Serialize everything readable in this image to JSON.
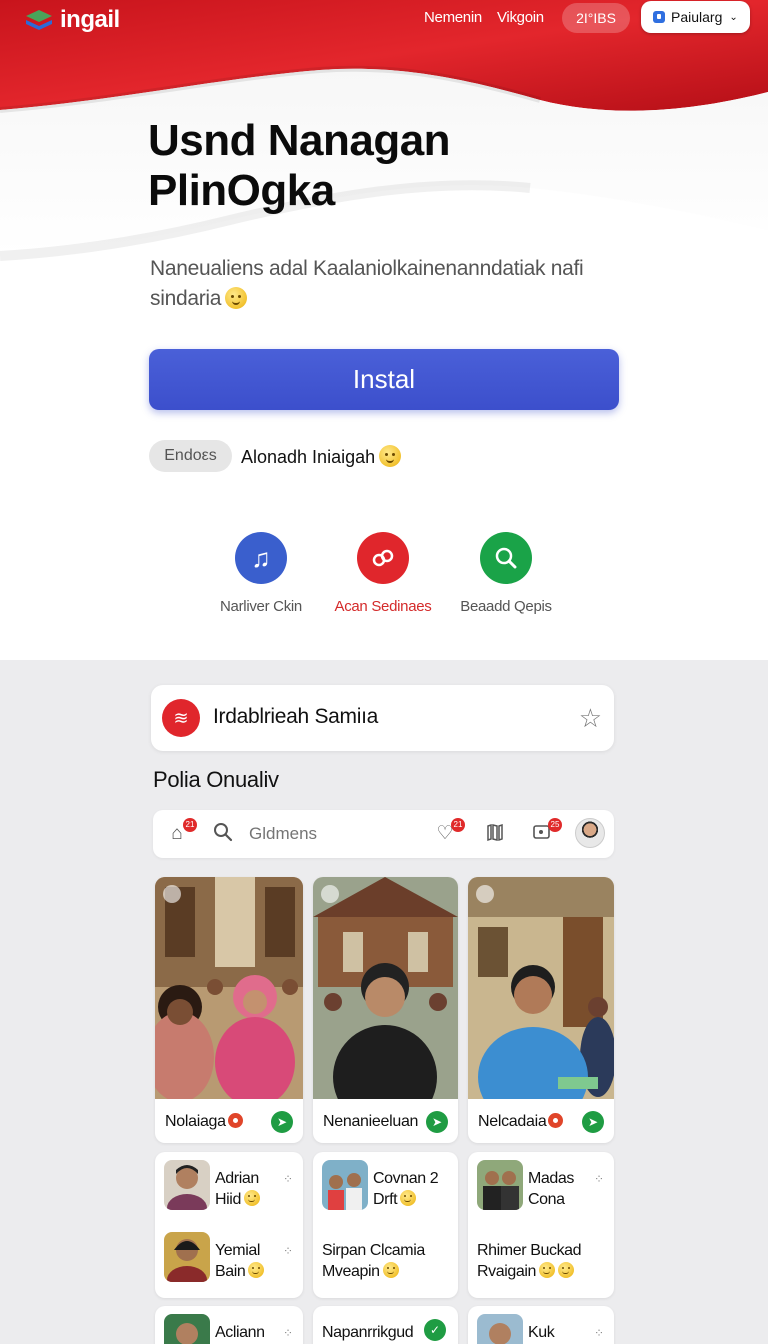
{
  "header": {
    "logo_text": "ingail",
    "nav": [
      "Nemenin",
      "Vikgoin"
    ],
    "pill": "2I°IBS",
    "language": "Paiularg"
  },
  "hero": {
    "title_line1": "Usnd Nanagan",
    "title_line2": "PlinOgka",
    "subtitle_line1": "Naneualiens adal Kaalaniolkainenanndatiak nafi",
    "subtitle_line2": "sindaria",
    "install_label": "Instal",
    "endorse_chip": "Endoεs",
    "endorse_text": "Alonadh Iniaigah"
  },
  "features": [
    {
      "label": "Narliver Ckin",
      "icon": "music-note-icon"
    },
    {
      "label": "Acan Sedinaes",
      "icon": "link-icon"
    },
    {
      "label": "Beaadd Qepis",
      "icon": "search-icon"
    }
  ],
  "panel": {
    "title": "Irdablrieah Samiıa"
  },
  "section": {
    "title": "Polia Onualiv"
  },
  "search": {
    "placeholder": "Gldmens",
    "badges": [
      "21",
      "21",
      "25"
    ]
  },
  "photo_cards": [
    {
      "caption": "Nolaiaga"
    },
    {
      "caption": "Nenanieeluan"
    },
    {
      "caption": "Nelcadaia"
    }
  ],
  "people": {
    "col1": [
      {
        "line1": "Adrian",
        "line2": "Hiid"
      },
      {
        "line1": "Yemial",
        "line2": "Bain"
      },
      {
        "line1": "Acliann",
        "line2": ""
      }
    ],
    "col2": [
      {
        "line1": "Covnan 2",
        "line2": "Drft"
      },
      {
        "line1": "Sirpan Clcamia",
        "line2": "Mveapin"
      },
      {
        "line1": "Napanrrikgud",
        "line2": ""
      }
    ],
    "col3": [
      {
        "line1": "Madas",
        "line2": "Cona"
      },
      {
        "line1": "Rhimer Buckad",
        "line2": "Rvaigain"
      },
      {
        "line1": "Kuk",
        "line2": ""
      }
    ]
  },
  "colors": {
    "brand_red": "#e0262c",
    "primary_blue": "#3c4fcc",
    "success_green": "#1f9c43"
  }
}
